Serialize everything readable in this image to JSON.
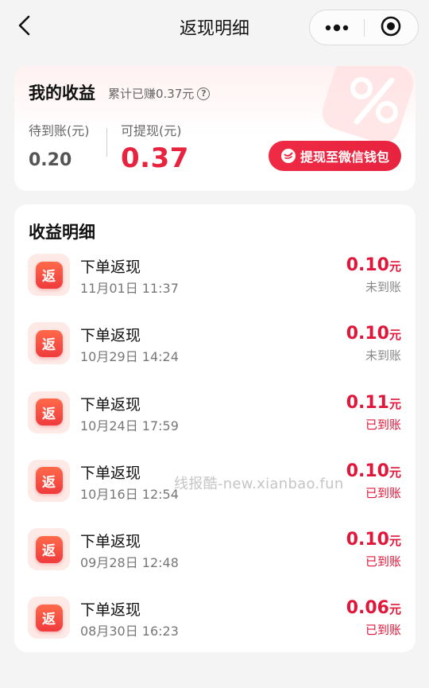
{
  "nav": {
    "title": "返现明细",
    "back_icon": "chevron-left-icon",
    "menu_icon": "more-dots-icon",
    "close_icon": "target-close-icon"
  },
  "summary": {
    "title": "我的收益",
    "total_text": "累计已赚0.37元",
    "help_glyph": "?",
    "pending_label": "待到账(元)",
    "pending_value": "0.20",
    "withdrawable_label": "可提现(元)",
    "withdrawable_value": "0.37",
    "withdraw_button": "提现至微信钱包",
    "accent": "#e8233f"
  },
  "detail": {
    "title": "收益明细",
    "badge_text": "返",
    "items": [
      {
        "title": "下单返现",
        "time": "11月01日 11:37",
        "amount": "0.10",
        "unit": "元",
        "status": "未到账",
        "arrived": false
      },
      {
        "title": "下单返现",
        "time": "10月29日 14:24",
        "amount": "0.10",
        "unit": "元",
        "status": "未到账",
        "arrived": false
      },
      {
        "title": "下单返现",
        "time": "10月24日 17:59",
        "amount": "0.11",
        "unit": "元",
        "status": "已到账",
        "arrived": true
      },
      {
        "title": "下单返现",
        "time": "10月16日 12:54",
        "amount": "0.10",
        "unit": "元",
        "status": "已到账",
        "arrived": true
      },
      {
        "title": "下单返现",
        "time": "09月28日 12:48",
        "amount": "0.10",
        "unit": "元",
        "status": "已到账",
        "arrived": true
      },
      {
        "title": "下单返现",
        "time": "08月30日 16:23",
        "amount": "0.06",
        "unit": "元",
        "status": "已到账",
        "arrived": true
      }
    ]
  },
  "watermark": "线报酷-new.xianbao.fun"
}
